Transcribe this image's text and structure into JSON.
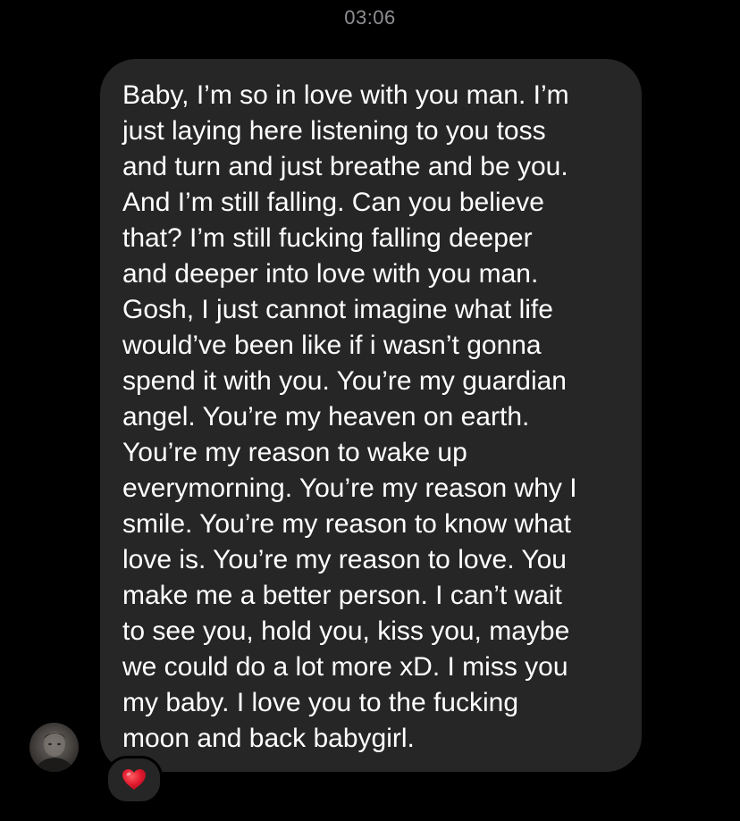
{
  "timestamp": "03:06",
  "message": {
    "lines": [
      "Baby, I’m so in love with you man. I’m",
      "just laying here listening to you toss",
      "and turn and just breathe and be you.",
      "And I’m still falling. Can you believe",
      "that? I’m still fucking falling deeper",
      "and deeper into love with you man.",
      "Gosh, I just cannot imagine what life",
      "would’ve been like if i wasn’t gonna",
      "spend it with you. You’re my guardian",
      "angel. You’re my heaven on earth.",
      "You’re my reason to wake up",
      "everymorning. You’re my reason why I",
      "smile. You’re my reason to know what",
      "love is. You’re my reason to love. You",
      "make me a better person. I can’t wait",
      "to see you, hold you, kiss you, maybe",
      "we could do a lot more xD. I miss you",
      "my baby. I love you to the fucking",
      "moon and back babygirl."
    ]
  },
  "sender": {
    "avatar_icon": "profile-photo"
  },
  "reaction": {
    "icon": "red-heart-icon",
    "color": "#e0182d"
  },
  "colors": {
    "background": "#000000",
    "bubble": "#262626",
    "text": "#ffffff",
    "timestamp": "#8e8e93"
  }
}
